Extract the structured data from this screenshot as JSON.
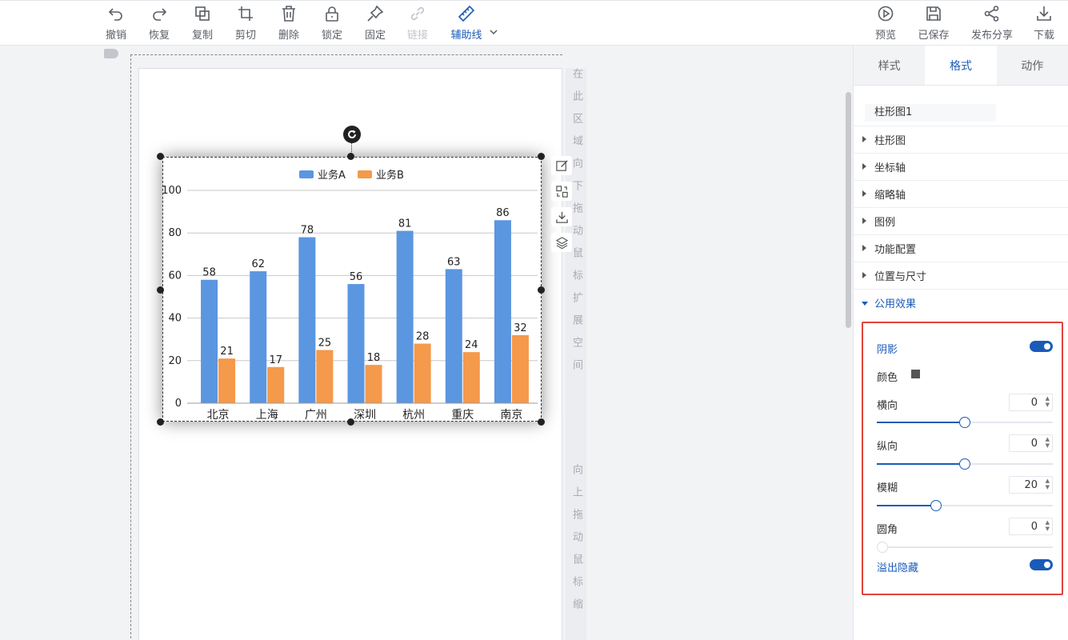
{
  "toolbar": {
    "left": [
      {
        "label": "撤销",
        "icon": "undo-icon"
      },
      {
        "label": "恢复",
        "icon": "redo-icon"
      },
      {
        "label": "复制",
        "icon": "copy-icon"
      },
      {
        "label": "剪切",
        "icon": "crop-icon"
      },
      {
        "label": "删除",
        "icon": "trash-icon"
      },
      {
        "label": "锁定",
        "icon": "lock-icon"
      },
      {
        "label": "固定",
        "icon": "pin-icon"
      },
      {
        "label": "链接",
        "icon": "link-icon",
        "disabled": true
      },
      {
        "label": "辅助线",
        "icon": "ruler-icon",
        "active": true
      }
    ],
    "right": [
      {
        "label": "预览",
        "icon": "play-icon"
      },
      {
        "label": "已保存",
        "icon": "save-icon"
      },
      {
        "label": "发布分享",
        "icon": "share-icon"
      },
      {
        "label": "下载",
        "icon": "download-icon"
      }
    ]
  },
  "hint": {
    "down_text": "在此区域向下拖动鼠标扩展空间",
    "up_text": "向上拖动鼠标缩"
  },
  "chart_data": {
    "type": "bar",
    "categories": [
      "北京",
      "上海",
      "广州",
      "深圳",
      "杭州",
      "重庆",
      "南京"
    ],
    "series": [
      {
        "name": "业务A",
        "values": [
          58,
          62,
          78,
          56,
          81,
          63,
          86
        ],
        "color": "#5b96e0"
      },
      {
        "name": "业务B",
        "values": [
          21,
          17,
          25,
          18,
          28,
          24,
          32
        ],
        "color": "#f5994a"
      }
    ],
    "yticks": [
      0,
      20,
      40,
      60,
      80,
      100
    ],
    "ylim": [
      0,
      100
    ],
    "grid": true,
    "legend": "top-center"
  },
  "panel": {
    "tabs": [
      "样式",
      "格式",
      "动作"
    ],
    "active_tab": "格式",
    "component_name": "柱形图1",
    "sections": [
      "柱形图",
      "坐标轴",
      "缩略轴",
      "图例",
      "功能配置",
      "位置与尺寸",
      "公用效果"
    ],
    "effects": {
      "shadow_label": "阴影",
      "shadow_on": true,
      "color_label": "颜色",
      "color": "#555555",
      "horizontal_label": "横向",
      "horizontal_value": "0",
      "vertical_label": "纵向",
      "vertical_value": "0",
      "blur_label": "模糊",
      "blur_value": "20",
      "radius_label": "圆角",
      "radius_value": "0",
      "overflow_label": "溢出隐藏",
      "overflow_on": true
    }
  }
}
